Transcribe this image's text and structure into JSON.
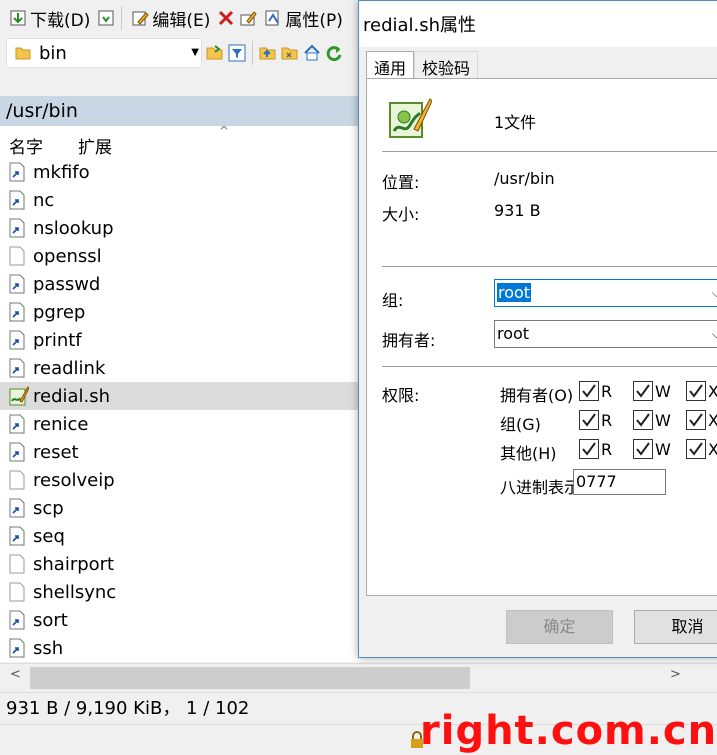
{
  "toolbar": {
    "download_label": "下载(D)",
    "edit_label": "编辑(E)",
    "properties_label": "属性(P)"
  },
  "pathbar": {
    "directory": "bin"
  },
  "location": {
    "path": "/usr/bin"
  },
  "columns": {
    "name": "名字",
    "ext": "扩展"
  },
  "files": [
    {
      "name": "mkfifo",
      "icon": "symlink-icon"
    },
    {
      "name": "nc",
      "icon": "symlink-icon"
    },
    {
      "name": "nslookup",
      "icon": "symlink-icon"
    },
    {
      "name": "openssl",
      "icon": "file-icon"
    },
    {
      "name": "passwd",
      "icon": "symlink-icon"
    },
    {
      "name": "pgrep",
      "icon": "symlink-icon"
    },
    {
      "name": "printf",
      "icon": "symlink-icon"
    },
    {
      "name": "readlink",
      "icon": "symlink-icon"
    },
    {
      "name": "redial.sh",
      "icon": "script-icon",
      "selected": true
    },
    {
      "name": "renice",
      "icon": "symlink-icon"
    },
    {
      "name": "reset",
      "icon": "symlink-icon"
    },
    {
      "name": "resolveip",
      "icon": "file-icon"
    },
    {
      "name": "scp",
      "icon": "symlink-icon"
    },
    {
      "name": "seq",
      "icon": "symlink-icon"
    },
    {
      "name": "shairport",
      "icon": "file-icon"
    },
    {
      "name": "shellsync",
      "icon": "file-icon"
    },
    {
      "name": "sort",
      "icon": "symlink-icon"
    },
    {
      "name": "ssh",
      "icon": "symlink-icon"
    }
  ],
  "status": {
    "summary": "931 B / 9,190 KiB，  1 / 102"
  },
  "watermark": "right.com.cn",
  "dialog": {
    "title": "redial.sh属性",
    "tabs": [
      "通用",
      "校验码"
    ],
    "file_count": "1文件",
    "location_label": "位置:",
    "location_value": "/usr/bin",
    "size_label": "大小:",
    "size_value": "931 B",
    "group_label": "组:",
    "group_value": "root",
    "owner_label": "拥有者:",
    "owner_value": "root",
    "perm_label": "权限:",
    "perm_rows": [
      {
        "label": "拥有者(O)",
        "r": true,
        "w": true,
        "x": true
      },
      {
        "label": "组(G)",
        "r": true,
        "w": true,
        "x": true
      },
      {
        "label": "其他(H)",
        "r": true,
        "w": true,
        "x": true
      }
    ],
    "perm_r": "R",
    "perm_w": "W",
    "perm_x": "X",
    "octal_label": "八进制表示",
    "octal_value": "0777",
    "ok_label": "确定",
    "cancel_label": "取消"
  }
}
